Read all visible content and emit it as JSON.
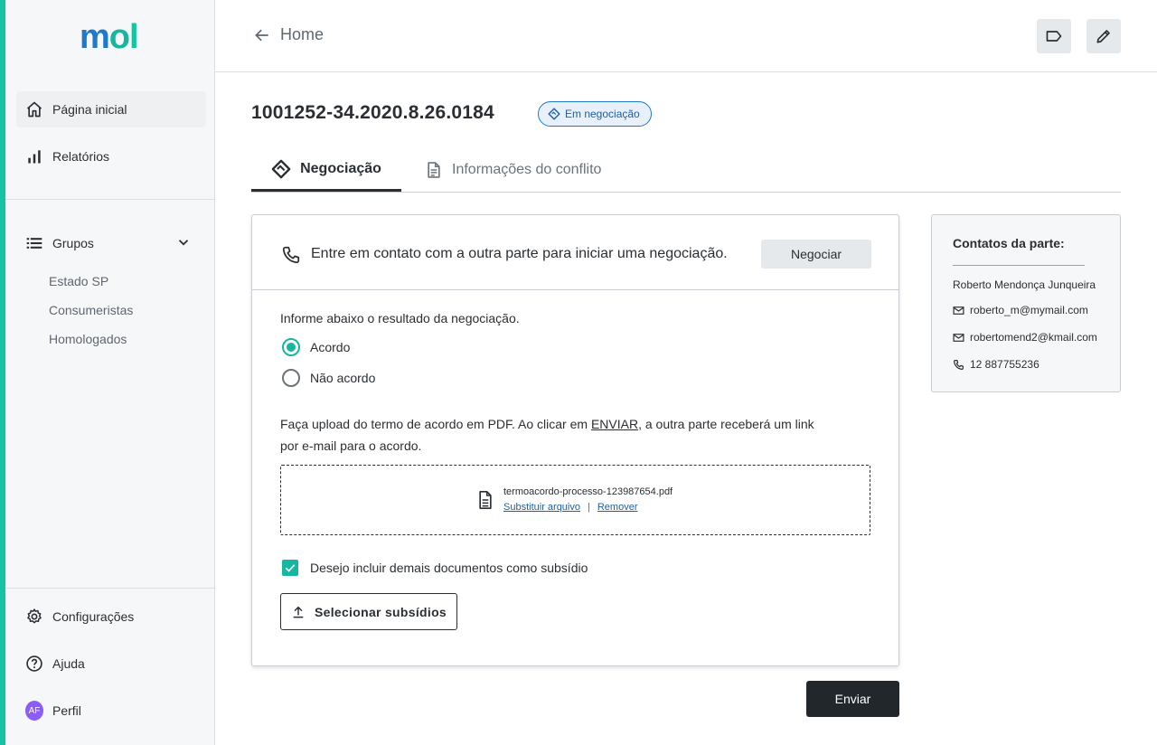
{
  "brand": {
    "logo_m": "m",
    "logo_o": "o",
    "logo_l": "l",
    "accent_color": "#16c4a4"
  },
  "sidebar": {
    "items": [
      {
        "label": "Página inicial",
        "icon": "home-icon"
      },
      {
        "label": "Relatórios",
        "icon": "bar-chart-icon"
      }
    ],
    "groups": {
      "label": "Grupos",
      "icon": "list-icon",
      "children": [
        "Estado SP",
        "Consumeristas",
        "Homologados"
      ]
    },
    "bottom": [
      {
        "label": "Configurações",
        "icon": "gear-icon"
      },
      {
        "label": "Ajuda",
        "icon": "help-icon"
      },
      {
        "label": "Perfil",
        "avatar": "AF"
      }
    ]
  },
  "header": {
    "back_label": "Home"
  },
  "page": {
    "title": "1001252-34.2020.8.26.0184",
    "status": "Em negociação",
    "tabs": [
      {
        "label": "Negociação",
        "icon": "handshake-icon"
      },
      {
        "label": "Informações do conflito",
        "icon": "document-icon"
      }
    ]
  },
  "negotiation": {
    "contact_prompt": "Entre em contato com a outra parte para iniciar uma negociação.",
    "negociar_label": "Negociar",
    "result_label": "Informe abaixo o resultado da negociação.",
    "options": [
      "Acordo",
      "Não acordo"
    ],
    "selected_option": "Acordo",
    "upload_text_before": "Faça upload do termo de acordo em PDF. Ao clicar em ",
    "upload_text_link": "ENVIAR",
    "upload_text_after": ", a outra parte receberá um link por e-mail para o acordo.",
    "file_name": "termoacordo-processo-123987654.pdf",
    "replace_label": "Substituir arquivo",
    "separator": "|",
    "remove_label": "Remover",
    "checkbox_label": "Desejo incluir demais documentos como subsídio",
    "checkbox_checked": true,
    "select_label": "Selecionar subsídios",
    "send_label": "Enviar"
  },
  "contacts": {
    "title": "Contatos da parte:",
    "name": "Roberto Mendonça Junqueira",
    "emails": [
      "roberto_m@mymail.com",
      "robertomend2@kmail.com"
    ],
    "phone": "12 887755236"
  }
}
